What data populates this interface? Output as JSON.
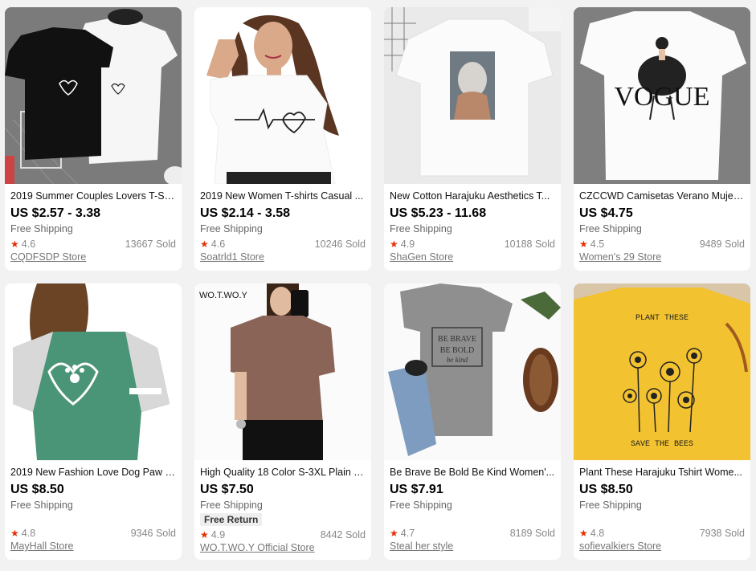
{
  "products": [
    {
      "title": "2019 Summer Couples Lovers T-Sh...",
      "price": "US $2.57 - 3.38",
      "shipping": "Free Shipping",
      "rating": "4.6",
      "sold": "13667 Sold",
      "store": "CQDFSDP Store"
    },
    {
      "title": "2019 New Women T-shirts Casual ...",
      "price": "US $2.14 - 3.58",
      "shipping": "Free Shipping",
      "rating": "4.6",
      "sold": "10246 Sold",
      "store": "Soatrld1 Store"
    },
    {
      "title": "New Cotton Harajuku Aesthetics T...",
      "price": "US $5.23 - 11.68",
      "shipping": "Free Shipping",
      "rating": "4.9",
      "sold": "10188 Sold",
      "store": "ShaGen Store"
    },
    {
      "title": "CZCCWD Camisetas Verano Mujer ...",
      "price": "US $4.75",
      "shipping": "Free Shipping",
      "rating": "4.5",
      "sold": "9489 Sold",
      "store": "Women's 29 Store",
      "image_text": "VOGUE"
    },
    {
      "title": "2019 New Fashion Love Dog Paw P...",
      "price": "US $8.50",
      "shipping": "Free Shipping",
      "rating": "4.8",
      "sold": "9346 Sold",
      "store": "MayHall Store"
    },
    {
      "title": "High Quality 18 Color S-3XL Plain T...",
      "price": "US $7.50",
      "shipping": "Free Shipping",
      "badge": "Free Return",
      "rating": "4.9",
      "sold": "8442 Sold",
      "store": "WO.T.WO.Y Official Store",
      "image_text": "WO.T.WO.Y"
    },
    {
      "title": "Be Brave Be Bold Be Kind Women'...",
      "price": "US $7.91",
      "shipping": "Free Shipping",
      "rating": "4.7",
      "sold": "8189 Sold",
      "store": "Steal her style",
      "image_text": [
        "BE BRAVE",
        "BE BOLD",
        "be kind"
      ]
    },
    {
      "title": "Plant These Harajuku Tshirt Wome...",
      "price": "US $8.50",
      "shipping": "Free Shipping",
      "rating": "4.8",
      "sold": "7938 Sold",
      "store": "sofievalkiers Store",
      "image_text": [
        "PLANT THESE",
        "SAVE THE BEES"
      ]
    }
  ],
  "colors": {
    "star": "#e62e04",
    "background": "#f2f2f2",
    "card": "#ffffff"
  },
  "icons": {
    "rating": "star-icon"
  }
}
